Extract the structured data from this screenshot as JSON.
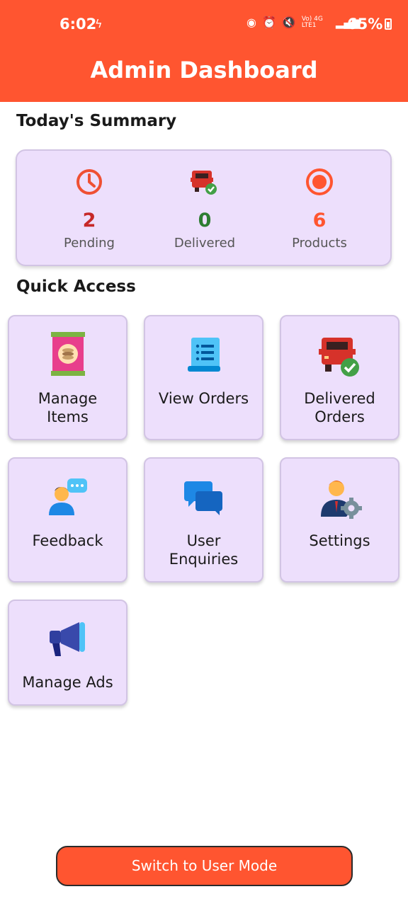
{
  "status_bar": {
    "time": "6:02",
    "signal_text": "Vo) 4G LTE1",
    "battery": "65%"
  },
  "header": {
    "title": "Admin Dashboard"
  },
  "summary": {
    "title": "Today's Summary",
    "stats": [
      {
        "value": "2",
        "label": "Pending",
        "color": "#c62828",
        "icon": "clock-icon"
      },
      {
        "value": "0",
        "label": "Delivered",
        "color": "#2e7d32",
        "icon": "delivery-truck-icon"
      },
      {
        "value": "6",
        "label": "Products",
        "color": "#ff5530",
        "icon": "target-icon"
      }
    ]
  },
  "quick_access": {
    "title": "Quick Access",
    "tiles": [
      {
        "label_line1": "Manage",
        "label_line2": "Items",
        "icon": "product-bag-icon"
      },
      {
        "label_line1": "View Orders",
        "label_line2": "",
        "icon": "order-list-icon"
      },
      {
        "label_line1": "Delivered",
        "label_line2": "Orders",
        "icon": "delivered-truck-icon"
      },
      {
        "label_line1": "Feedback",
        "label_line2": "",
        "icon": "feedback-icon"
      },
      {
        "label_line1": "User",
        "label_line2": "Enquiries",
        "icon": "chat-bubbles-icon"
      },
      {
        "label_line1": "Settings",
        "label_line2": "",
        "icon": "user-settings-icon"
      },
      {
        "label_line1": "Manage Ads",
        "label_line2": "",
        "icon": "megaphone-icon"
      }
    ]
  },
  "footer": {
    "switch_label": "Switch to User Mode"
  },
  "colors": {
    "accent": "#ff5530",
    "card_bg": "#eddffc",
    "pending": "#c62828",
    "delivered": "#2e7d32"
  }
}
